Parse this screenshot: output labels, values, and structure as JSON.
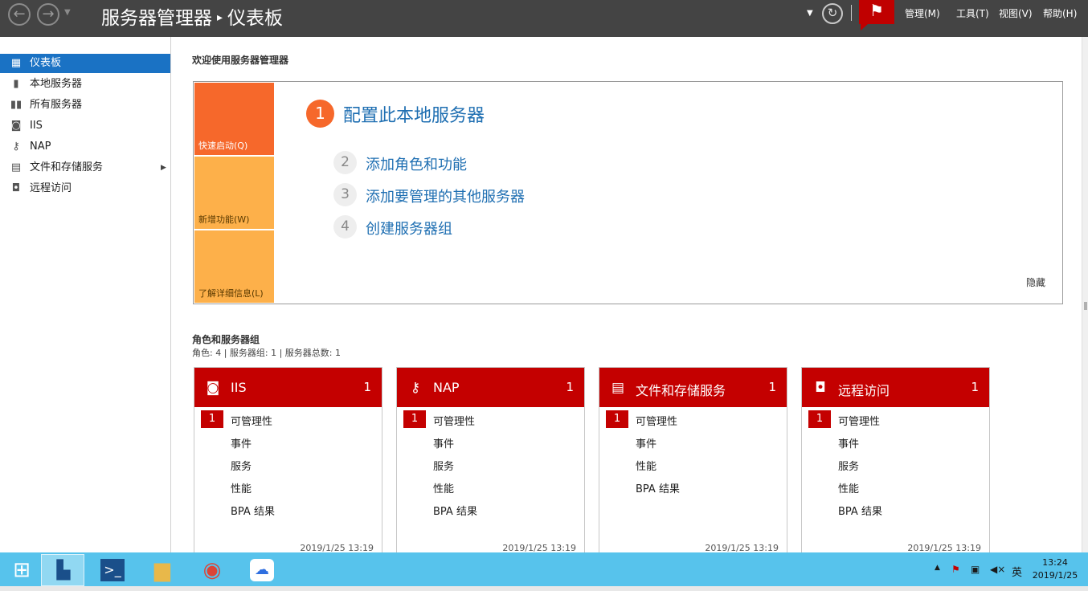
{
  "header": {
    "breadcrumb_root": "服务器管理器",
    "breadcrumb_current": "仪表板",
    "menu": [
      "管理(M)",
      "工具(T)",
      "视图(V)",
      "帮助(H)"
    ]
  },
  "sidebar": {
    "items": [
      {
        "label": "仪表板",
        "icon": "dashboard-icon"
      },
      {
        "label": "本地服务器",
        "icon": "server-icon"
      },
      {
        "label": "所有服务器",
        "icon": "servers-icon"
      },
      {
        "label": "IIS",
        "icon": "iis-icon"
      },
      {
        "label": "NAP",
        "icon": "nap-icon"
      },
      {
        "label": "文件和存储服务",
        "icon": "file-storage-icon"
      },
      {
        "label": "远程访问",
        "icon": "remote-access-icon"
      }
    ]
  },
  "welcome": {
    "title": "欢迎使用服务器管理器",
    "tiles": [
      "快速启动(Q)",
      "新增功能(W)",
      "了解详细信息(L)"
    ],
    "steps": [
      {
        "num": "1",
        "label": "配置此本地服务器"
      },
      {
        "num": "2",
        "label": "添加角色和功能"
      },
      {
        "num": "3",
        "label": "添加要管理的其他服务器"
      },
      {
        "num": "4",
        "label": "创建服务器组"
      }
    ],
    "hide_label": "隐藏",
    "colors": {
      "orange": "#f6682b",
      "light_orange": "#fdb04a",
      "link_blue": "#1f6fb2"
    }
  },
  "roles": {
    "title": "角色和服务器组",
    "subtitle": "角色: 4 | 服务器组: 1 | 服务器总数: 1",
    "header_color": "#c40000",
    "cards": [
      {
        "title": "IIS",
        "count": "1",
        "badge": "1",
        "rows": [
          "可管理性",
          "事件",
          "服务",
          "性能",
          "BPA 结果"
        ],
        "time": "2019/1/25 13:19"
      },
      {
        "title": "NAP",
        "count": "1",
        "badge": "1",
        "rows": [
          "可管理性",
          "事件",
          "服务",
          "性能",
          "BPA 结果"
        ],
        "time": "2019/1/25 13:19"
      },
      {
        "title": "文件和存储服务",
        "count": "1",
        "badge": "1",
        "rows": [
          "可管理性",
          "事件",
          "性能",
          "BPA 结果"
        ],
        "time": "2019/1/25 13:19"
      },
      {
        "title": "远程访问",
        "count": "1",
        "badge": "1",
        "rows": [
          "可管理性",
          "事件",
          "服务",
          "性能",
          "BPA 结果"
        ],
        "time": "2019/1/25 13:19"
      }
    ]
  },
  "taskbar": {
    "ime": "英",
    "time": "13:24",
    "date": "2019/1/25"
  }
}
